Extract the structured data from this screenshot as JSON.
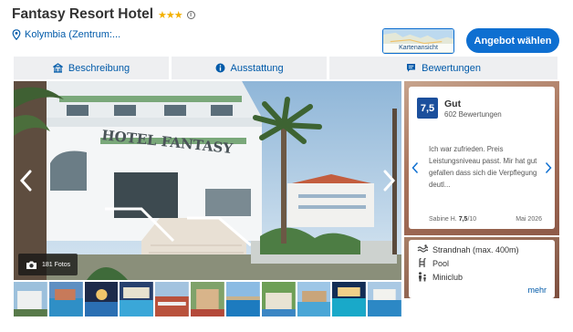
{
  "header": {
    "hotel_name": "Fantasy Resort Hotel",
    "stars": "★★★",
    "stars_count": 3,
    "info_icon": "i",
    "location": "Kolymbia (Zentrum:...",
    "map_button_label": "Kartenansicht",
    "offer_button_label": "Angebot wählen"
  },
  "tabs": [
    {
      "label": "Beschreibung",
      "icon": "building-icon"
    },
    {
      "label": "Ausstattung",
      "icon": "info-icon"
    },
    {
      "label": "Bewertungen",
      "icon": "speech-bubble-icon"
    }
  ],
  "gallery": {
    "photo_count": "181 Fotos",
    "sign_text": "HOTEL FANTASY"
  },
  "review": {
    "score": "7,5",
    "rating_word": "Gut",
    "rating_count": "602 Bewertungen",
    "text": "Ich war zufrieden. Preis Leistungsniveau passt. Mir hat gut gefallen dass sich die Verpflegung deutl...",
    "author": "Sabine H.",
    "author_score": "7,5",
    "author_score_max": "/10",
    "date": "Mai 2026"
  },
  "features": {
    "items": [
      {
        "label": "Strandnah (max. 400m)",
        "icon": "waves-icon"
      },
      {
        "label": "Pool",
        "icon": "pool-ladder-icon"
      },
      {
        "label": "Miniclub",
        "icon": "family-icon"
      }
    ],
    "more_label": "mehr"
  },
  "colors": {
    "accent_blue": "#0e6fd1",
    "link_blue": "#005aa9",
    "score_blue": "#1b4f9c",
    "star_gold": "#f3b000",
    "tab_bg": "#eeeff1"
  }
}
